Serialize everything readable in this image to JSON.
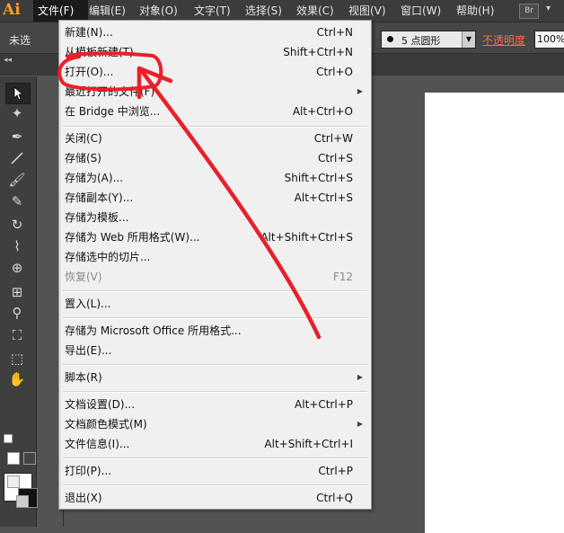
{
  "app": {
    "logo_text": "Ai",
    "brand_color": "#f7a11a"
  },
  "menubar": {
    "items": [
      {
        "label": "文件(F)",
        "active": true
      },
      {
        "label": "编辑(E)"
      },
      {
        "label": "对象(O)"
      },
      {
        "label": "文字(T)"
      },
      {
        "label": "选择(S)"
      },
      {
        "label": "效果(C)"
      },
      {
        "label": "视图(V)"
      },
      {
        "label": "窗口(W)"
      },
      {
        "label": "帮助(H)"
      }
    ],
    "bridge_badge": "Br",
    "overflow_icon": "chevron-down-icon"
  },
  "controlbar": {
    "doc_label": "未选",
    "brush_label": "5 点圆形",
    "opacity_label": "不透明度",
    "opacity_value": "100%"
  },
  "file_menu": {
    "items": [
      {
        "label": "新建(N)...",
        "shortcut": "Ctrl+N"
      },
      {
        "label": "从模板新建(T)...",
        "shortcut": "Shift+Ctrl+N"
      },
      {
        "label": "打开(O)...",
        "shortcut": "Ctrl+O"
      },
      {
        "label": "最近打开的文件(F)",
        "shortcut": "",
        "submenu": true
      },
      {
        "label": "在 Bridge 中浏览...",
        "shortcut": "Alt+Ctrl+O"
      },
      {
        "label": "关闭(C)",
        "shortcut": "Ctrl+W"
      },
      {
        "label": "存储(S)",
        "shortcut": "Ctrl+S"
      },
      {
        "label": "存储为(A)...",
        "shortcut": "Shift+Ctrl+S"
      },
      {
        "label": "存储副本(Y)...",
        "shortcut": "Alt+Ctrl+S"
      },
      {
        "label": "存储为模板...",
        "shortcut": ""
      },
      {
        "label": "存储为 Web 所用格式(W)...",
        "shortcut": "Alt+Shift+Ctrl+S"
      },
      {
        "label": "存储选中的切片...",
        "shortcut": ""
      },
      {
        "label": "恢复(V)",
        "shortcut": "F12",
        "disabled": true
      },
      {
        "label": "置入(L)...",
        "shortcut": ""
      },
      {
        "label": "存储为 Microsoft Office 所用格式...",
        "shortcut": ""
      },
      {
        "label": "导出(E)...",
        "shortcut": ""
      },
      {
        "label": "脚本(R)",
        "shortcut": "",
        "submenu": true
      },
      {
        "label": "文档设置(D)...",
        "shortcut": "Alt+Ctrl+P"
      },
      {
        "label": "文档颜色模式(M)",
        "shortcut": "",
        "submenu": true
      },
      {
        "label": "文件信息(I)...",
        "shortcut": "Alt+Shift+Ctrl+I"
      },
      {
        "label": "打印(P)...",
        "shortcut": "Ctrl+P"
      },
      {
        "label": "退出(X)",
        "shortcut": "Ctrl+Q"
      }
    ]
  },
  "tools": [
    "selection-tool-icon",
    "magic-wand-icon",
    "pen-tool-icon",
    "line-tool-icon",
    "paintbrush-tool-icon",
    "blob-brush-icon",
    "rotate-tool-icon",
    "warp-tool-icon",
    "shape-builder-icon",
    "mesh-tool-icon",
    "eyedropper-tool-icon",
    "symbol-sprayer-icon",
    "artboard-tool-icon",
    "hand-tool-icon"
  ],
  "annotation": {
    "color": "#e8202a"
  }
}
